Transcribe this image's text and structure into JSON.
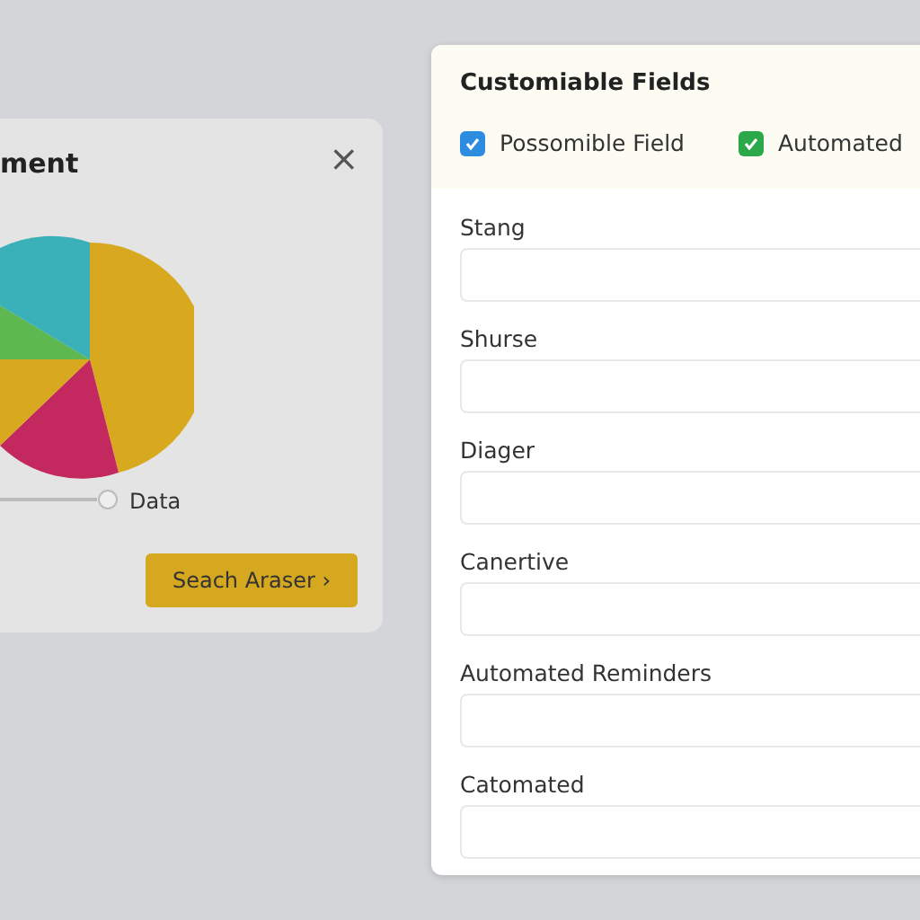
{
  "back_panel": {
    "title": "ment",
    "close": "×",
    "data_label": "Data",
    "button": "Seach Araser ›"
  },
  "fields_panel": {
    "title": "Customiable Fields",
    "checkboxes": [
      {
        "label": "Possomible Field",
        "checked": true,
        "color": "#2d8be0"
      },
      {
        "label": "Automated",
        "checked": true,
        "color": "#2aa84a"
      }
    ],
    "fields": [
      {
        "label": "Stang"
      },
      {
        "label": "Shurse"
      },
      {
        "label": "Diager"
      },
      {
        "label": "Canertive"
      },
      {
        "label": "Automated Reminders"
      },
      {
        "label": "Catomated"
      }
    ]
  }
}
